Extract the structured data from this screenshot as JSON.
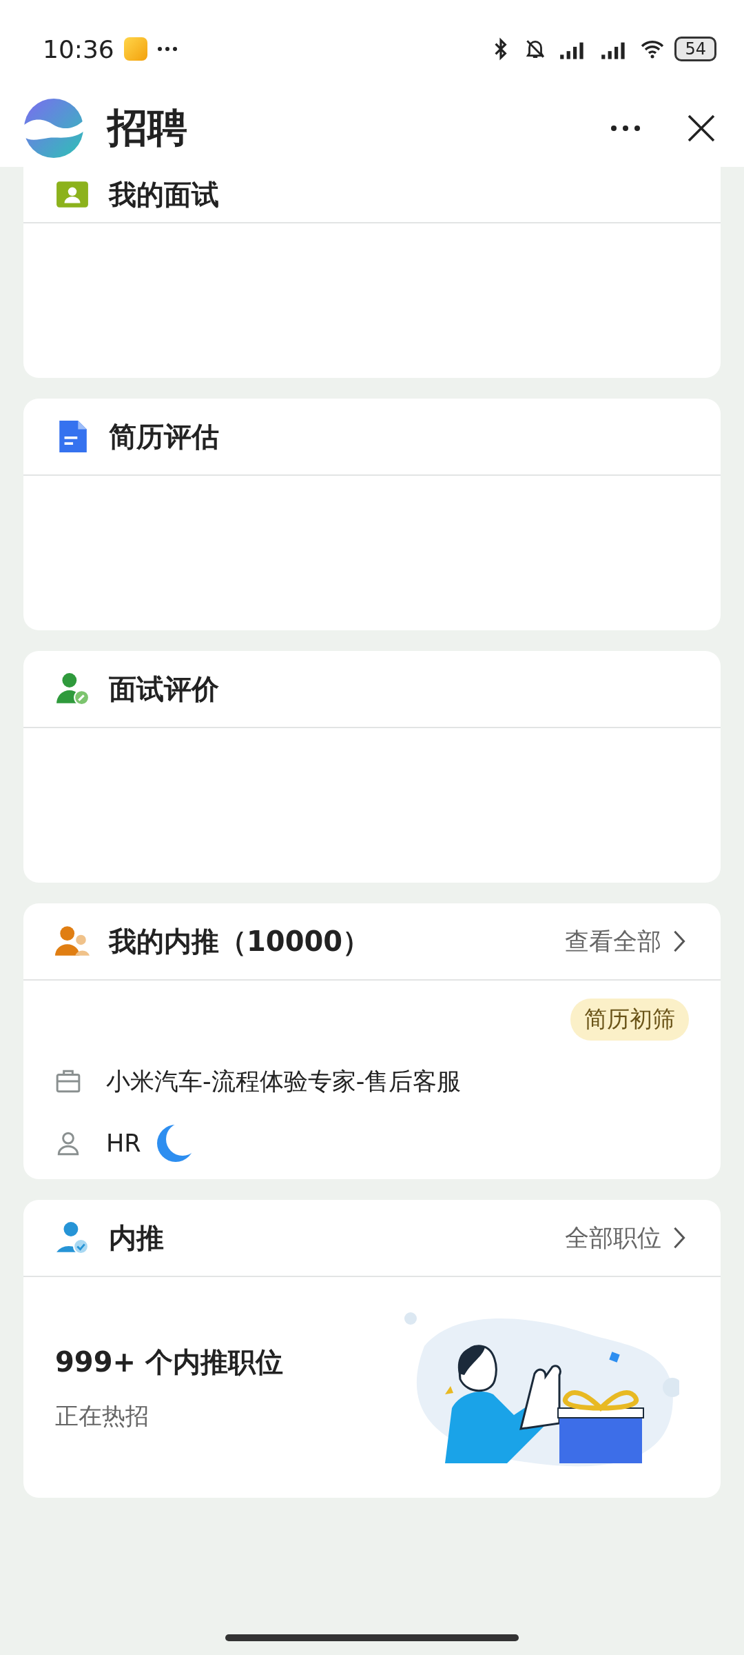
{
  "status_bar": {
    "time": "10:36",
    "battery": "54"
  },
  "header": {
    "title": "招聘"
  },
  "sections": [
    {
      "kind": "interview",
      "title": "我的面试"
    },
    {
      "kind": "resume",
      "title": "简历评估"
    },
    {
      "kind": "evaluation",
      "title": "面试评价"
    },
    {
      "kind": "referrals",
      "title": "我的内推（10000）",
      "link": "查看全部",
      "referral": {
        "tag": "简历初筛",
        "job": "小米汽车-流程体验专家-售后客服",
        "hr_label": "HR"
      }
    },
    {
      "kind": "positions",
      "title": "内推",
      "link": "全部职位",
      "promo": {
        "count": "999+ 个内推职位",
        "subtitle": "正在热招"
      }
    }
  ]
}
